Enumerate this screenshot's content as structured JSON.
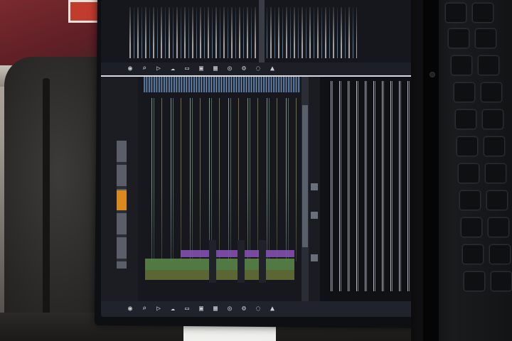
{
  "scene": {
    "description_visible_text": "",
    "accent_colors": {
      "code_purple_highlight": "#8a52b8",
      "code_green_highlight": "#5d8a4a",
      "tab_orange": "#d98a1e",
      "screen_background": "#111318",
      "red_box": "#c23c2e"
    },
    "taskbar_icons": [
      "app-icon",
      "search-icon",
      "terminal-icon",
      "cloud-icon",
      "folder-icon",
      "window-icon",
      "grid-icon",
      "globe-icon",
      "settings-icon",
      "chat-icon",
      "android-icon"
    ],
    "keyboard_glyphs": [
      "",
      "",
      "",
      "",
      "",
      "",
      "",
      "",
      "",
      "",
      "",
      "",
      "",
      ""
    ]
  }
}
